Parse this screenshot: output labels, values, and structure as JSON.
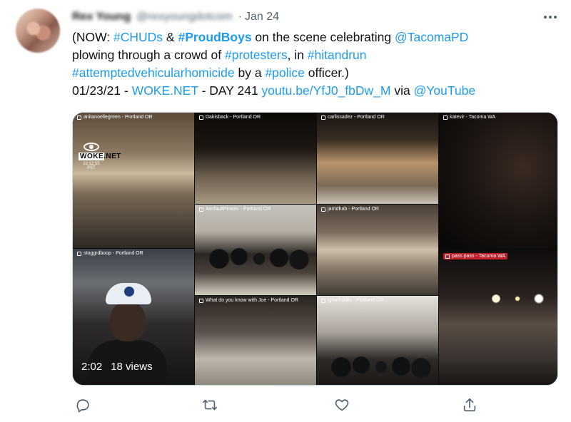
{
  "tweet": {
    "display_name": "Rex Young",
    "handle": "@rexyoungdotcom",
    "date": "Jan 24",
    "lines": [
      [
        {
          "t": "(NOW: "
        },
        {
          "t": "#CHUDs",
          "link": true
        },
        {
          "t": " & "
        },
        {
          "t": "#ProudBoys",
          "link": true,
          "bold": true
        },
        {
          "t": " on the scene celebrating "
        },
        {
          "t": "@TacomaPD",
          "link": true
        }
      ],
      [
        {
          "t": "plowing through a crowd of "
        },
        {
          "t": "#protesters",
          "link": true
        },
        {
          "t": ", in "
        },
        {
          "t": "#hitandrun",
          "link": true
        }
      ],
      [
        {
          "t": "#attemptedvehicularhomicide",
          "link": true
        },
        {
          "t": " by a "
        },
        {
          "t": "#police",
          "link": true
        },
        {
          "t": " officer.)"
        }
      ],
      [
        {
          "t": "01/23/21 - "
        },
        {
          "t": "WOKE.NET",
          "link": true
        },
        {
          "t": " - DAY 241 "
        },
        {
          "t": "youtu.be/YfJ0_fbDw_M",
          "link": true
        },
        {
          "t": " via "
        },
        {
          "t": "@YouTube",
          "link": true
        }
      ]
    ]
  },
  "media": {
    "cells": [
      {
        "label": "anitanoellegreen - Portland OR"
      },
      {
        "label": "Dakisback - Portland OR"
      },
      {
        "label": "carlissadez - Portland OR"
      },
      {
        "label": "katevir - Tacoma WA"
      },
      {
        "label": "AssfaultPirates - Portland OR"
      },
      {
        "label": "jarridhab - Portland OR"
      },
      {
        "label": "stoggrdboop - Portland OR"
      },
      {
        "label": "What do you know with Joe - Portland OR"
      },
      {
        "label": "ignarhusky - Portland OR"
      },
      {
        "label": "pass pass - Tacoma WA"
      }
    ],
    "logo_name": "WOKE.NET",
    "logo_time": "22:12:55 PST",
    "duration": "2:02",
    "views": "18 views"
  },
  "icons": {
    "more": "more-icon",
    "reply": "reply-icon",
    "retweet": "retweet-icon",
    "like": "like-icon",
    "share": "share-icon"
  },
  "colors": {
    "link": "#1d9bf0",
    "muted": "#536471",
    "text": "#0f1419",
    "live_badge": "#c0202a"
  }
}
